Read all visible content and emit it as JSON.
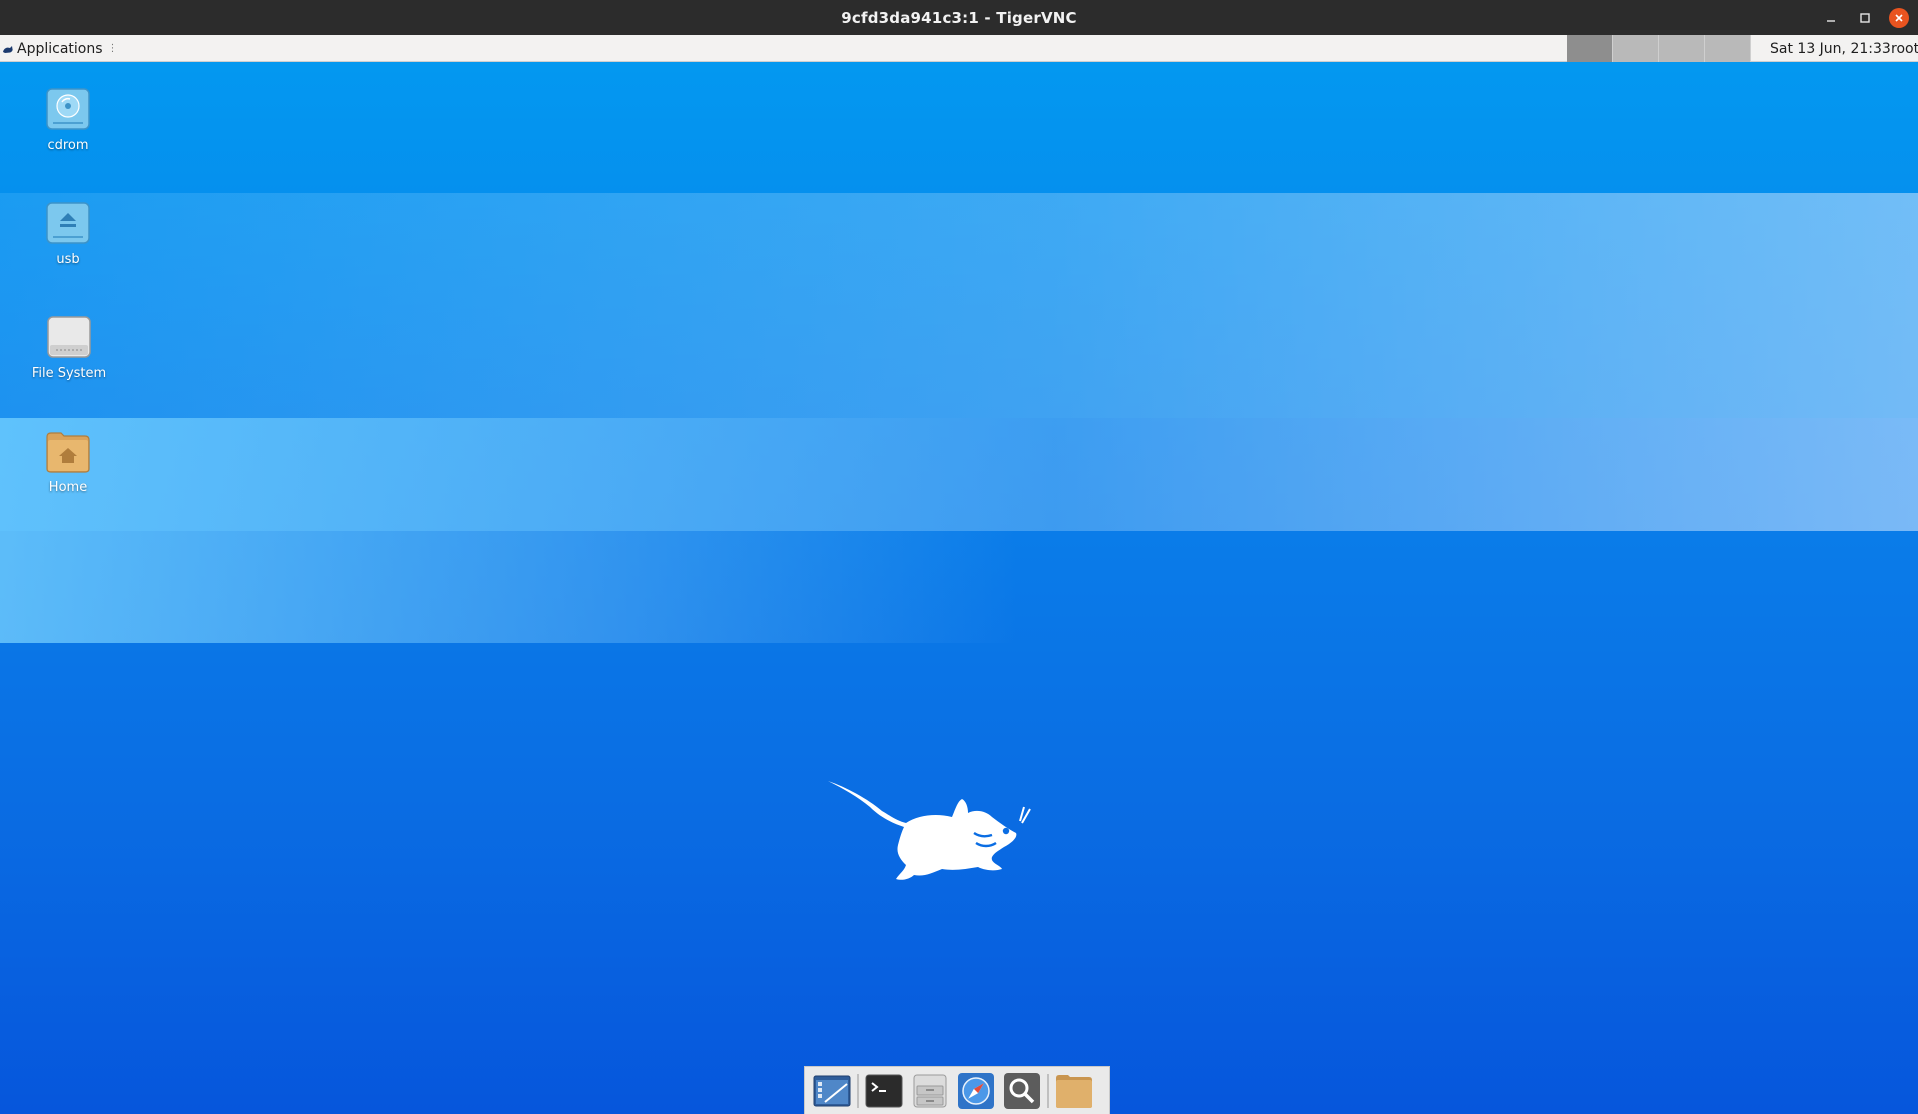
{
  "window": {
    "title": "9cfd3da941c3:1 - TigerVNC"
  },
  "panel": {
    "applications_label": "Applications",
    "workspaces": [
      "",
      "",
      "",
      ""
    ],
    "active_workspace": 0,
    "clock": "Sat 13 Jun, 21:33",
    "user": "root"
  },
  "desktop": {
    "icons": [
      {
        "label": "cdrom",
        "icon": "cdrom-icon"
      },
      {
        "label": "usb",
        "icon": "usb-drive-icon"
      },
      {
        "label": "File System",
        "icon": "hard-drive-icon"
      },
      {
        "label": "Home",
        "icon": "home-folder-icon"
      }
    ],
    "wallpaper_logo": "xfce-mouse-logo"
  },
  "dock": {
    "items": [
      {
        "name": "show-desktop",
        "icon": "show-desktop-icon"
      },
      {
        "name": "terminal",
        "icon": "terminal-icon"
      },
      {
        "name": "file-manager",
        "icon": "file-manager-icon"
      },
      {
        "name": "web-browser",
        "icon": "web-browser-icon"
      },
      {
        "name": "app-finder",
        "icon": "search-icon"
      },
      {
        "name": "home-folder",
        "icon": "folder-icon"
      }
    ]
  },
  "colors": {
    "titlebar": "#2c2c2c",
    "close_button": "#e95420",
    "panel": "#f3f2f1",
    "desktop_top": "#0398f0",
    "desktop_bottom": "#0656dc"
  }
}
